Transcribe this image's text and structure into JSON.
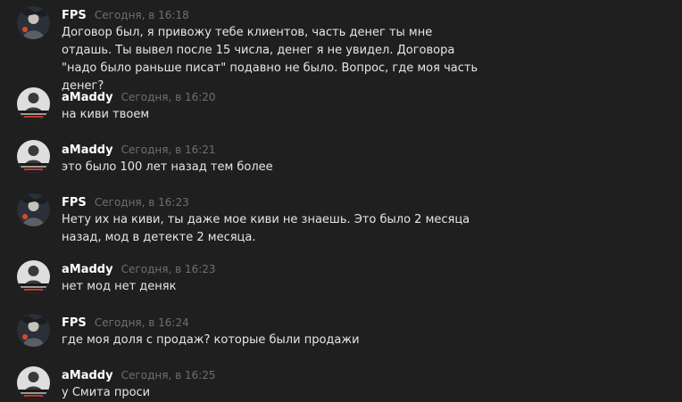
{
  "messages": [
    {
      "author": "FPS",
      "time": "Сегодня, в 16:18",
      "text": "Договор был, я привожу тебе клиентов, часть денег ты мне отдашь. Ты вывел после 15 числа, денег я не увидел. Договора \"надо было раньше писат\" подавно не было. Вопрос, где моя часть денег?",
      "avatar_icon": "fps-avatar-icon"
    },
    {
      "author": "aMaddy",
      "time": "Сегодня, в 16:20",
      "text": "на киви твоем",
      "avatar_icon": "amaddy-avatar-icon"
    },
    {
      "author": "aMaddy",
      "time": "Сегодня, в 16:21",
      "text": "это было 100 лет назад тем более",
      "avatar_icon": "amaddy-avatar-icon"
    },
    {
      "author": "FPS",
      "time": "Сегодня, в 16:23",
      "text": "Нету их на киви, ты даже мое киви не знаешь. Это было 2 месяца назад, мод в детекте 2 месяца.",
      "avatar_icon": "fps-avatar-icon"
    },
    {
      "author": "aMaddy",
      "time": "Сегодня, в 16:23",
      "text": "нет мод нет деняк",
      "avatar_icon": "amaddy-avatar-icon"
    },
    {
      "author": "FPS",
      "time": "Сегодня, в 16:24",
      "text": "где моя доля с продаж? которые были продажи",
      "avatar_icon": "fps-avatar-icon"
    },
    {
      "author": "aMaddy",
      "time": "Сегодня, в 16:25",
      "text": "у Смита проси",
      "avatar_icon": "amaddy-avatar-icon"
    }
  ],
  "colors": {
    "background": "#1f1f1f",
    "author": "#ffffff",
    "timestamp": "#6f6f6f",
    "text": "#e6e6e6"
  }
}
